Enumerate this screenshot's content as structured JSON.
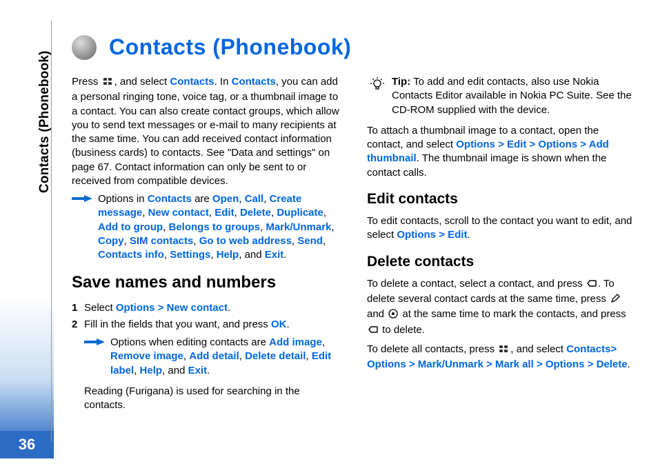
{
  "page_number": "36",
  "side_title": "Contacts (Phonebook)",
  "title": "Contacts (Phonebook)",
  "intro": {
    "p1_prefix": "Press ",
    "p1_mid": ", and select ",
    "p1_link1": "Contacts",
    "p1_mid2": ". In ",
    "p1_link2": "Contacts",
    "p1_tail": ", you can add a personal ringing tone, voice tag, or a thumbnail image to a contact. You can also create contact groups, which allow you to send text messages or e-mail to many recipients at the same time. You can add received contact information (business cards) to contacts. See \"Data and settings\" on page 67. Contact information can only be sent to or received from compatible devices."
  },
  "opts1": {
    "lead": "Options in ",
    "contacts": "Contacts",
    "are": " are ",
    "items": [
      "Open",
      "Call",
      "Create message",
      "New contact",
      "Edit",
      "Delete",
      "Duplicate",
      "Add to group",
      "Belongs to groups",
      "Mark/Unmark",
      "Copy",
      "SIM contacts",
      "Go to web address",
      "Send",
      "Contacts info",
      "Settings",
      "Help"
    ],
    "and": ", and ",
    "last": "Exit",
    "end": "."
  },
  "save_heading": "Save names and numbers",
  "steps": {
    "s1_pre": "Select ",
    "s1_link": "Options > New contact",
    "s1_end": ".",
    "s2_pre": "Fill in the fields that you want, and press ",
    "s2_link": "OK",
    "s2_end": "."
  },
  "opts2": {
    "lead": "Options when editing contacts are ",
    "items": [
      "Add image",
      "Remove image",
      "Add detail",
      "Delete detail",
      "Edit label",
      "Help"
    ],
    "and": ", and ",
    "last": "Exit",
    "end": "."
  },
  "furigana": "Reading (Furigana) is used for searching in the contacts.",
  "tip": {
    "label": "Tip:",
    "text": " To add and edit contacts, also use Nokia Contacts Editor available in Nokia PC Suite. See the CD-ROM supplied with the device."
  },
  "thumb": {
    "pre": "To attach a thumbnail image to a contact, open the contact, and select ",
    "link": "Options > Edit > Options > Add thumbnail",
    "post": ". The thumbnail image is shown when the contact calls."
  },
  "edit_heading": "Edit contacts",
  "edit_body": {
    "pre": "To edit contacts, scroll to the contact you want to edit, and select ",
    "link": "Options > Edit",
    "end": "."
  },
  "delete_heading": "Delete contacts",
  "delete_body": {
    "p1a": "To delete a contact, select a contact, and press ",
    "p1b": ". To delete several contact cards at the same time, press ",
    "p1c": " and ",
    "p1d": " at the same time to mark the contacts, and press ",
    "p1e": " to delete.",
    "p2a": "To delete all contacts, press ",
    "p2b": ", and select ",
    "p2link": "Contacts> Options > Mark/Unmark > Mark all > Options > Delete",
    "p2end": "."
  }
}
